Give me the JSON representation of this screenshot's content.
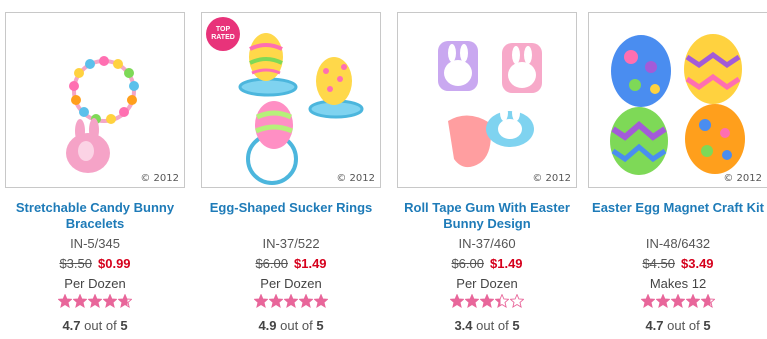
{
  "products": [
    {
      "name": "Stretchable Candy Bunny Bracelets",
      "sku": "IN-5/345",
      "old_price": "$3.50",
      "new_price": "$0.99",
      "unit": "Per Dozen",
      "rating_value": "4.7",
      "rating_suffix": "out of",
      "rating_max": "5",
      "rating": 4.7,
      "copyright": "© 2012"
    },
    {
      "name": "Egg-Shaped Sucker Rings",
      "sku": "IN-37/522",
      "old_price": "$6.00",
      "new_price": "$1.49",
      "unit": "Per Dozen",
      "rating_value": "4.9",
      "rating_suffix": "out of",
      "rating_max": "5",
      "rating": 4.9,
      "copyright": "© 2012",
      "badge": "TOP RATED"
    },
    {
      "name": "Roll Tape Gum With Easter Bunny Design",
      "sku": "IN-37/460",
      "old_price": "$6.00",
      "new_price": "$1.49",
      "unit": "Per Dozen",
      "rating_value": "3.4",
      "rating_suffix": "out of",
      "rating_max": "5",
      "rating": 3.4,
      "copyright": "© 2012"
    },
    {
      "name": "Easter Egg Magnet Craft Kit",
      "sku": "IN-48/6432",
      "old_price": "$4.50",
      "new_price": "$3.49",
      "unit": "Makes 12",
      "rating_value": "4.7",
      "rating_suffix": "out of",
      "rating_max": "5",
      "rating": 4.7,
      "copyright": "© 2012"
    }
  ],
  "colors": {
    "link": "#1e7bb8",
    "sale": "#d6001c",
    "star": "#e8669a",
    "star_empty": "#e8669a",
    "badge": "#e8337a"
  }
}
